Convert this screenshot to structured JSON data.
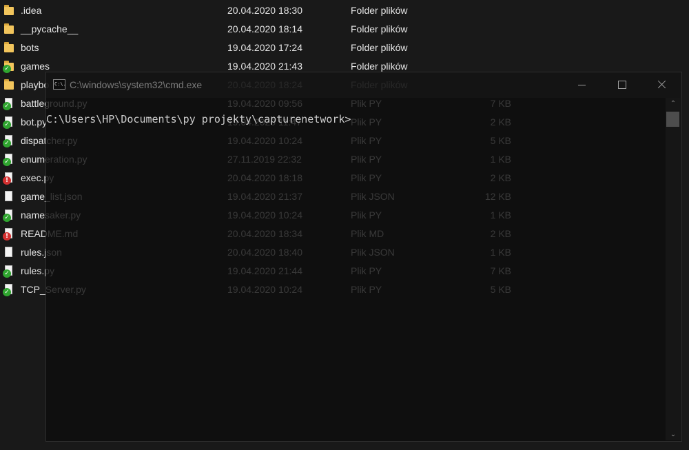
{
  "explorer": {
    "rows": [
      {
        "name": ".idea",
        "date": "20.04.2020 18:30",
        "type": "Folder plików",
        "size": "",
        "icon": "folder-icon",
        "badge": ""
      },
      {
        "name": "__pycache__",
        "date": "20.04.2020 18:14",
        "type": "Folder plików",
        "size": "",
        "icon": "folder-icon",
        "badge": ""
      },
      {
        "name": "bots",
        "date": "19.04.2020 17:24",
        "type": "Folder plików",
        "size": "",
        "icon": "folder-icon",
        "badge": ""
      },
      {
        "name": "games",
        "date": "19.04.2020 21:43",
        "type": "Folder plików",
        "size": "",
        "icon": "folder-icon",
        "badge": "ok"
      },
      {
        "name": "playbo",
        "date": "20.04.2020 18:24",
        "type": "Folder plików",
        "size": "",
        "icon": "folder-icon",
        "badge": ""
      },
      {
        "name": "battleground.py",
        "date": "19.04.2020 09:56",
        "type": "Plik PY",
        "size": "7 KB",
        "icon": "python-file-icon",
        "badge": "ok"
      },
      {
        "name": "bot.py",
        "date": "19.04.2020 11:47",
        "type": "Plik PY",
        "size": "2 KB",
        "icon": "python-file-icon",
        "badge": "ok"
      },
      {
        "name": "dispatcher.py",
        "date": "19.04.2020 10:24",
        "type": "Plik PY",
        "size": "5 KB",
        "icon": "python-file-icon",
        "badge": "ok"
      },
      {
        "name": "enumeration.py",
        "date": "27.11.2019 22:32",
        "type": "Plik PY",
        "size": "1 KB",
        "icon": "python-file-icon",
        "badge": "ok"
      },
      {
        "name": "exec.py",
        "date": "20.04.2020 18:18",
        "type": "Plik PY",
        "size": "2 KB",
        "icon": "python-file-icon",
        "badge": "err"
      },
      {
        "name": "game_list.json",
        "date": "19.04.2020 21:37",
        "type": "Plik JSON",
        "size": "12 KB",
        "icon": "json-file-icon",
        "badge": ""
      },
      {
        "name": "namesaker.py",
        "date": "19.04.2020 10:24",
        "type": "Plik PY",
        "size": "1 KB",
        "icon": "python-file-icon",
        "badge": "ok"
      },
      {
        "name": "README.md",
        "date": "20.04.2020 18:34",
        "type": "Plik MD",
        "size": "2 KB",
        "icon": "markdown-file-icon",
        "badge": "err"
      },
      {
        "name": "rules.json",
        "date": "20.04.2020 18:40",
        "type": "Plik JSON",
        "size": "1 KB",
        "icon": "json-file-icon",
        "badge": ""
      },
      {
        "name": "rules.py",
        "date": "19.04.2020 21:44",
        "type": "Plik PY",
        "size": "7 KB",
        "icon": "python-file-icon",
        "badge": "ok"
      },
      {
        "name": "TCP_Server.py",
        "date": "19.04.2020 10:24",
        "type": "Plik PY",
        "size": "5 KB",
        "icon": "python-file-icon",
        "badge": "ok"
      }
    ]
  },
  "cmd": {
    "app_icon_text": "C:\\.",
    "title": "C:\\windows\\system32\\cmd.exe",
    "prompt": "C:\\Users\\HP\\Documents\\py projekty\\capturenetwork>"
  },
  "colors": {
    "explorer_bg": "#191919",
    "cmd_bg": "#0c0c0c",
    "badge_ok": "#2fa52f",
    "badge_err": "#d43030",
    "folder": "#f2c55c"
  }
}
